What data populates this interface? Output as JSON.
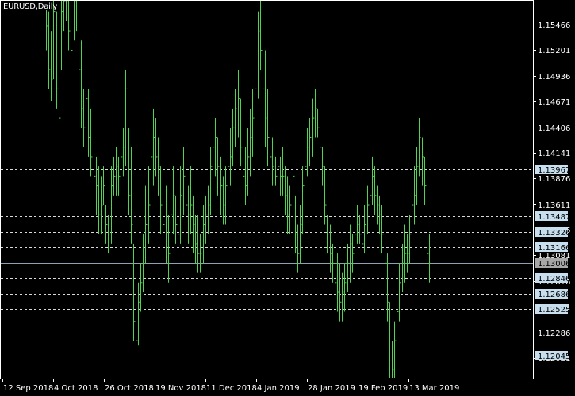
{
  "chart_title": "EURUSD,Daily",
  "colors": {
    "background": "#000000",
    "candles": "#52d152",
    "frame": "#ffffff",
    "dashed_lines": "#d9d9d9",
    "current_price_line": "#8ea0b4",
    "level_label_bg": "#c6deee",
    "current_label_bg": "#a7a7a7"
  },
  "price_scale": {
    "ticks": [
      "1.15466",
      "1.15201",
      "1.14936",
      "1.14671",
      "1.14406",
      "1.14141",
      "1.13876",
      "1.13611",
      "1.13346",
      "1.13081",
      "1.12816",
      "1.12551",
      "1.12286",
      "1.12021"
    ]
  },
  "horizontal_levels": [
    {
      "label": "1.13967"
    },
    {
      "label": "1.13487"
    },
    {
      "label": "1.13326"
    },
    {
      "label": "1.13166"
    },
    {
      "label": "1.12846"
    },
    {
      "label": "1.12686"
    },
    {
      "label": "1.12525"
    },
    {
      "label": "1.12045"
    }
  ],
  "current_price": {
    "label": "1.13006"
  },
  "time_axis": {
    "labels": [
      "12 Sep 2018",
      "4 Oct 2018",
      "26 Oct 2018",
      "19 Nov 2018",
      "11 Dec 2018",
      "4 Jan 2019",
      "28 Jan 2019",
      "19 Feb 2019",
      "13 Mar 2019"
    ]
  },
  "chart_data": {
    "type": "bar",
    "symbol": "EURUSD",
    "timeframe": "Daily",
    "candles": [
      {
        "h": 1.1562,
        "l": 1.152,
        "c": 1.1545
      },
      {
        "h": 1.156,
        "l": 1.148,
        "c": 1.15
      },
      {
        "h": 1.154,
        "l": 1.1468,
        "c": 1.149
      },
      {
        "h": 1.158,
        "l": 1.149,
        "c": 1.156
      },
      {
        "h": 1.156,
        "l": 1.146,
        "c": 1.148
      },
      {
        "h": 1.152,
        "l": 1.142,
        "c": 1.145
      },
      {
        "h": 1.158,
        "l": 1.15,
        "c": 1.156
      },
      {
        "h": 1.16,
        "l": 1.154,
        "c": 1.158
      },
      {
        "h": 1.16,
        "l": 1.155,
        "c": 1.158
      },
      {
        "h": 1.159,
        "l": 1.152,
        "c": 1.154
      },
      {
        "h": 1.156,
        "l": 1.15,
        "c": 1.152
      },
      {
        "h": 1.16,
        "l": 1.153,
        "c": 1.158
      },
      {
        "h": 1.16,
        "l": 1.154,
        "c": 1.157
      },
      {
        "h": 1.1575,
        "l": 1.148,
        "c": 1.15
      },
      {
        "h": 1.153,
        "l": 1.144,
        "c": 1.146
      },
      {
        "h": 1.148,
        "l": 1.142,
        "c": 1.144
      },
      {
        "h": 1.15,
        "l": 1.143,
        "c": 1.147
      },
      {
        "h": 1.148,
        "l": 1.141,
        "c": 1.143
      },
      {
        "h": 1.146,
        "l": 1.139,
        "c": 1.141
      },
      {
        "h": 1.142,
        "l": 1.137,
        "c": 1.139
      },
      {
        "h": 1.141,
        "l": 1.135,
        "c": 1.138
      },
      {
        "h": 1.14,
        "l": 1.133,
        "c": 1.135
      },
      {
        "h": 1.139,
        "l": 1.133,
        "c": 1.136
      },
      {
        "h": 1.14,
        "l": 1.136,
        "c": 1.138
      },
      {
        "h": 1.136,
        "l": 1.132,
        "c": 1.134
      },
      {
        "h": 1.135,
        "l": 1.131,
        "c": 1.133
      },
      {
        "h": 1.14,
        "l": 1.132,
        "c": 1.138
      },
      {
        "h": 1.141,
        "l": 1.137,
        "c": 1.139
      },
      {
        "h": 1.142,
        "l": 1.137,
        "c": 1.14
      },
      {
        "h": 1.141,
        "l": 1.137,
        "c": 1.139
      },
      {
        "h": 1.142,
        "l": 1.138,
        "c": 1.141
      },
      {
        "h": 1.144,
        "l": 1.139,
        "c": 1.142
      },
      {
        "h": 1.15,
        "l": 1.14,
        "c": 1.148
      },
      {
        "h": 1.144,
        "l": 1.135,
        "c": 1.137
      },
      {
        "h": 1.142,
        "l": 1.132,
        "c": 1.134
      },
      {
        "h": 1.132,
        "l": 1.122,
        "c": 1.124
      },
      {
        "h": 1.126,
        "l": 1.1215,
        "c": 1.122
      },
      {
        "h": 1.128,
        "l": 1.1215,
        "c": 1.126
      },
      {
        "h": 1.13,
        "l": 1.125,
        "c": 1.128
      },
      {
        "h": 1.133,
        "l": 1.127,
        "c": 1.13
      },
      {
        "h": 1.138,
        "l": 1.13,
        "c": 1.134
      },
      {
        "h": 1.14,
        "l": 1.132,
        "c": 1.136
      },
      {
        "h": 1.144,
        "l": 1.137,
        "c": 1.141
      },
      {
        "h": 1.146,
        "l": 1.138,
        "c": 1.143
      },
      {
        "h": 1.145,
        "l": 1.139,
        "c": 1.141
      },
      {
        "h": 1.143,
        "l": 1.137,
        "c": 1.14
      },
      {
        "h": 1.14,
        "l": 1.133,
        "c": 1.136
      },
      {
        "h": 1.137,
        "l": 1.132,
        "c": 1.134
      },
      {
        "h": 1.138,
        "l": 1.13,
        "c": 1.133
      },
      {
        "h": 1.135,
        "l": 1.128,
        "c": 1.131
      },
      {
        "h": 1.138,
        "l": 1.131,
        "c": 1.135
      },
      {
        "h": 1.14,
        "l": 1.133,
        "c": 1.137
      },
      {
        "h": 1.137,
        "l": 1.132,
        "c": 1.134
      },
      {
        "h": 1.135,
        "l": 1.131,
        "c": 1.133
      },
      {
        "h": 1.14,
        "l": 1.132,
        "c": 1.137
      },
      {
        "h": 1.142,
        "l": 1.135,
        "c": 1.139
      },
      {
        "h": 1.14,
        "l": 1.134,
        "c": 1.136
      },
      {
        "h": 1.138,
        "l": 1.132,
        "c": 1.135
      },
      {
        "h": 1.14,
        "l": 1.133,
        "c": 1.136
      },
      {
        "h": 1.137,
        "l": 1.131,
        "c": 1.134
      },
      {
        "h": 1.135,
        "l": 1.13,
        "c": 1.132
      },
      {
        "h": 1.135,
        "l": 1.129,
        "c": 1.131
      },
      {
        "h": 1.133,
        "l": 1.129,
        "c": 1.131
      },
      {
        "h": 1.136,
        "l": 1.13,
        "c": 1.134
      },
      {
        "h": 1.137,
        "l": 1.132,
        "c": 1.135
      },
      {
        "h": 1.138,
        "l": 1.133,
        "c": 1.136
      },
      {
        "h": 1.142,
        "l": 1.135,
        "c": 1.14
      },
      {
        "h": 1.144,
        "l": 1.138,
        "c": 1.142
      },
      {
        "h": 1.145,
        "l": 1.139,
        "c": 1.143
      },
      {
        "h": 1.143,
        "l": 1.137,
        "c": 1.14
      },
      {
        "h": 1.141,
        "l": 1.135,
        "c": 1.138
      },
      {
        "h": 1.139,
        "l": 1.134,
        "c": 1.136
      },
      {
        "h": 1.14,
        "l": 1.134,
        "c": 1.138
      },
      {
        "h": 1.142,
        "l": 1.137,
        "c": 1.14
      },
      {
        "h": 1.144,
        "l": 1.138,
        "c": 1.141
      },
      {
        "h": 1.146,
        "l": 1.14,
        "c": 1.144
      },
      {
        "h": 1.148,
        "l": 1.142,
        "c": 1.146
      },
      {
        "h": 1.15,
        "l": 1.143,
        "c": 1.147
      },
      {
        "h": 1.147,
        "l": 1.14,
        "c": 1.142
      },
      {
        "h": 1.144,
        "l": 1.137,
        "c": 1.139
      },
      {
        "h": 1.142,
        "l": 1.136,
        "c": 1.138
      },
      {
        "h": 1.144,
        "l": 1.137,
        "c": 1.141
      },
      {
        "h": 1.146,
        "l": 1.139,
        "c": 1.143
      },
      {
        "h": 1.148,
        "l": 1.141,
        "c": 1.145
      },
      {
        "h": 1.15,
        "l": 1.144,
        "c": 1.148
      },
      {
        "h": 1.156,
        "l": 1.147,
        "c": 1.154
      },
      {
        "h": 1.158,
        "l": 1.15,
        "c": 1.152
      },
      {
        "h": 1.154,
        "l": 1.146,
        "c": 1.148
      },
      {
        "h": 1.152,
        "l": 1.142,
        "c": 1.145
      },
      {
        "h": 1.148,
        "l": 1.14,
        "c": 1.143
      },
      {
        "h": 1.145,
        "l": 1.139,
        "c": 1.141
      },
      {
        "h": 1.143,
        "l": 1.138,
        "c": 1.14
      },
      {
        "h": 1.141,
        "l": 1.138,
        "c": 1.139
      },
      {
        "h": 1.142,
        "l": 1.138,
        "c": 1.14
      },
      {
        "h": 1.141,
        "l": 1.137,
        "c": 1.139
      },
      {
        "h": 1.142,
        "l": 1.137,
        "c": 1.139
      },
      {
        "h": 1.14,
        "l": 1.135,
        "c": 1.137
      },
      {
        "h": 1.139,
        "l": 1.133,
        "c": 1.135
      },
      {
        "h": 1.138,
        "l": 1.133,
        "c": 1.136
      },
      {
        "h": 1.141,
        "l": 1.135,
        "c": 1.139
      },
      {
        "h": 1.137,
        "l": 1.131,
        "c": 1.133
      },
      {
        "h": 1.134,
        "l": 1.129,
        "c": 1.131
      },
      {
        "h": 1.136,
        "l": 1.13,
        "c": 1.134
      },
      {
        "h": 1.14,
        "l": 1.133,
        "c": 1.138
      },
      {
        "h": 1.142,
        "l": 1.137,
        "c": 1.14
      },
      {
        "h": 1.144,
        "l": 1.139,
        "c": 1.142
      },
      {
        "h": 1.145,
        "l": 1.14,
        "c": 1.143
      },
      {
        "h": 1.147,
        "l": 1.141,
        "c": 1.145
      },
      {
        "h": 1.148,
        "l": 1.143,
        "c": 1.146
      },
      {
        "h": 1.146,
        "l": 1.143,
        "c": 1.144
      },
      {
        "h": 1.144,
        "l": 1.14,
        "c": 1.142
      },
      {
        "h": 1.142,
        "l": 1.138,
        "c": 1.14
      },
      {
        "h": 1.14,
        "l": 1.134,
        "c": 1.136
      },
      {
        "h": 1.135,
        "l": 1.131,
        "c": 1.133
      },
      {
        "h": 1.134,
        "l": 1.129,
        "c": 1.131
      },
      {
        "h": 1.132,
        "l": 1.128,
        "c": 1.13
      },
      {
        "h": 1.131,
        "l": 1.126,
        "c": 1.128
      },
      {
        "h": 1.131,
        "l": 1.125,
        "c": 1.127
      },
      {
        "h": 1.13,
        "l": 1.124,
        "c": 1.126
      },
      {
        "h": 1.129,
        "l": 1.124,
        "c": 1.127
      },
      {
        "h": 1.13,
        "l": 1.125,
        "c": 1.128
      },
      {
        "h": 1.132,
        "l": 1.127,
        "c": 1.13
      },
      {
        "h": 1.134,
        "l": 1.128,
        "c": 1.132
      },
      {
        "h": 1.133,
        "l": 1.129,
        "c": 1.131
      },
      {
        "h": 1.135,
        "l": 1.13,
        "c": 1.133
      },
      {
        "h": 1.136,
        "l": 1.132,
        "c": 1.134
      },
      {
        "h": 1.135,
        "l": 1.132,
        "c": 1.133
      },
      {
        "h": 1.134,
        "l": 1.13,
        "c": 1.132
      },
      {
        "h": 1.136,
        "l": 1.131,
        "c": 1.134
      },
      {
        "h": 1.138,
        "l": 1.133,
        "c": 1.136
      },
      {
        "h": 1.14,
        "l": 1.134,
        "c": 1.137
      },
      {
        "h": 1.141,
        "l": 1.136,
        "c": 1.139
      },
      {
        "h": 1.14,
        "l": 1.135,
        "c": 1.137
      },
      {
        "h": 1.138,
        "l": 1.134,
        "c": 1.136
      },
      {
        "h": 1.137,
        "l": 1.133,
        "c": 1.135
      },
      {
        "h": 1.136,
        "l": 1.131,
        "c": 1.133
      },
      {
        "h": 1.134,
        "l": 1.128,
        "c": 1.13
      },
      {
        "h": 1.131,
        "l": 1.124,
        "c": 1.126
      },
      {
        "h": 1.126,
        "l": 1.118,
        "c": 1.12
      },
      {
        "h": 1.122,
        "l": 1.117,
        "c": 1.119
      },
      {
        "h": 1.124,
        "l": 1.118,
        "c": 1.122
      },
      {
        "h": 1.127,
        "l": 1.121,
        "c": 1.125
      },
      {
        "h": 1.13,
        "l": 1.124,
        "c": 1.128
      },
      {
        "h": 1.132,
        "l": 1.127,
        "c": 1.13
      },
      {
        "h": 1.134,
        "l": 1.128,
        "c": 1.131
      },
      {
        "h": 1.133,
        "l": 1.129,
        "c": 1.131
      },
      {
        "h": 1.135,
        "l": 1.13,
        "c": 1.133
      },
      {
        "h": 1.138,
        "l": 1.132,
        "c": 1.136
      },
      {
        "h": 1.14,
        "l": 1.134,
        "c": 1.137
      },
      {
        "h": 1.142,
        "l": 1.136,
        "c": 1.14
      },
      {
        "h": 1.145,
        "l": 1.139,
        "c": 1.143
      },
      {
        "h": 1.143,
        "l": 1.138,
        "c": 1.141
      },
      {
        "h": 1.141,
        "l": 1.136,
        "c": 1.138
      },
      {
        "h": 1.138,
        "l": 1.13,
        "c": 1.131
      },
      {
        "h": 1.133,
        "l": 1.128,
        "c": 1.13
      }
    ]
  }
}
